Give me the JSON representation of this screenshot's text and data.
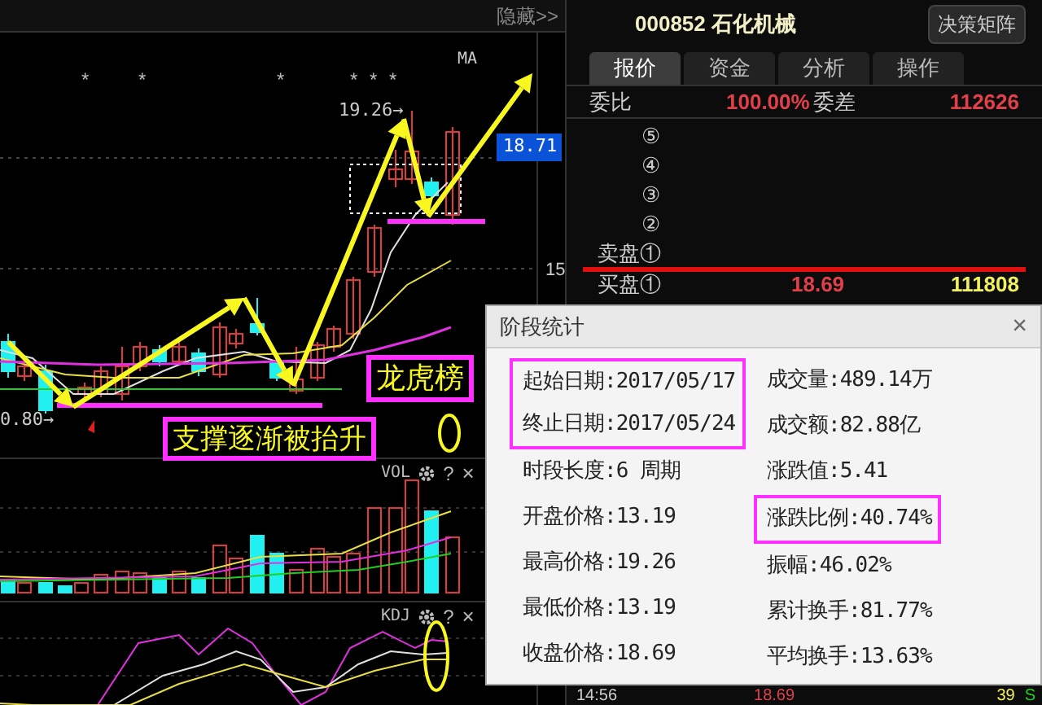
{
  "toolbar": {
    "hide_button": "隐藏>>"
  },
  "price_chart": {
    "indicator": "MA",
    "markers": [
      {
        "text": "*"
      },
      {
        "text": "*"
      },
      {
        "text": "*"
      },
      {
        "text": "*"
      },
      {
        "text": "*"
      },
      {
        "text": "*"
      }
    ],
    "high_label": "19.26→",
    "low_label": "0.80→",
    "axis_label": "15",
    "current_price": "18.71",
    "annotations": [
      {
        "kind": "boxed",
        "text": "龙虎榜"
      },
      {
        "kind": "boxed",
        "text": "支撑逐渐被抬升"
      }
    ]
  },
  "volume_panel": {
    "label": "VOL",
    "help": "?",
    "close": "×"
  },
  "kdj_panel": {
    "label": "KDJ",
    "help": "?",
    "close": "×"
  },
  "quote": {
    "title": "000852 石化机械",
    "button": "决策矩阵",
    "tabs": [
      {
        "label": "报价",
        "selected": true
      },
      {
        "label": "资金",
        "selected": false
      },
      {
        "label": "分析",
        "selected": false
      },
      {
        "label": "操作",
        "selected": false
      }
    ],
    "ratio": {
      "label": "委比",
      "value": "100.00%",
      "diff_label": "委差",
      "diff_value": "112626"
    },
    "asks": [
      {
        "label": "⑤"
      },
      {
        "label": "④"
      },
      {
        "label": "③"
      },
      {
        "label": "②"
      },
      {
        "label": "卖盘①"
      }
    ],
    "bids": [
      {
        "label": "买盘①",
        "price": "18.69",
        "volume": "111808"
      }
    ],
    "last_trade": {
      "time": "14:56",
      "price": "18.69",
      "volume": "39",
      "side": "S"
    }
  },
  "dialog": {
    "title": "阶段统计",
    "close": "×",
    "columns": [
      [
        {
          "text": "起始日期:2017/05/17",
          "highlighted": true
        },
        {
          "text": "终止日期:2017/05/24",
          "highlighted": true
        },
        {
          "text": "时段长度:6 周期",
          "highlighted": false
        },
        {
          "text": "开盘价格:13.19",
          "highlighted": false
        },
        {
          "text": "最高价格:19.26",
          "highlighted": false
        },
        {
          "text": "最低价格:13.19",
          "highlighted": false
        },
        {
          "text": "收盘价格:18.69",
          "highlighted": false
        }
      ],
      [
        {
          "text": "成交量:489.14万",
          "highlighted": false
        },
        {
          "text": "成交额:82.88亿",
          "highlighted": false
        },
        {
          "text": "涨跌值:5.41",
          "highlighted": false
        },
        {
          "text": "涨跌比例:40.74%",
          "highlighted": true
        },
        {
          "text": "振幅:46.02%",
          "highlighted": false
        },
        {
          "text": "累计换手:81.77%",
          "highlighted": false
        },
        {
          "text": "平均换手:13.63%",
          "highlighted": false
        }
      ]
    ]
  }
}
